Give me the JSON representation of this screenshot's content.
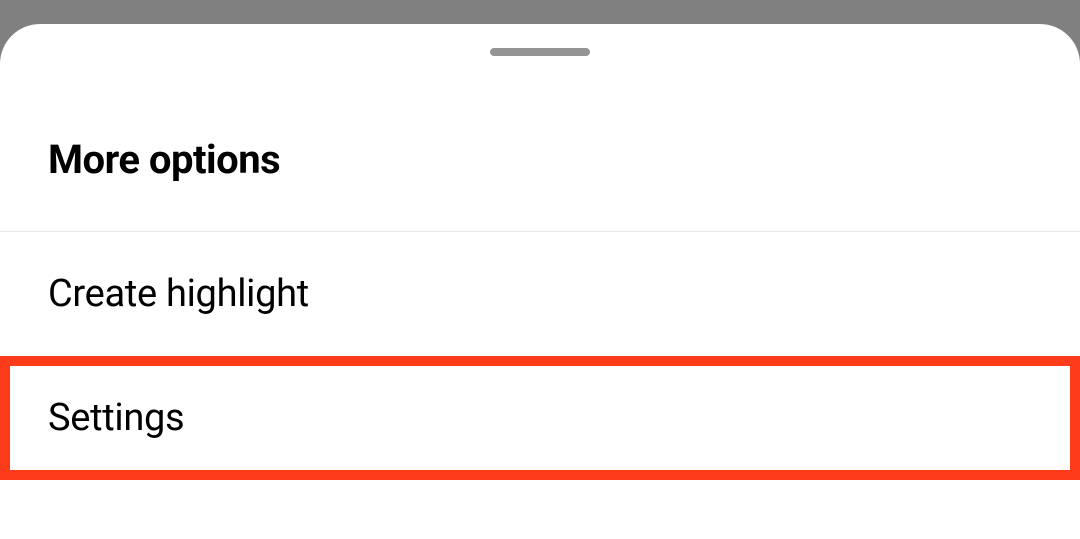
{
  "sheet": {
    "title": "More options",
    "items": [
      {
        "label": "Create highlight"
      },
      {
        "label": "Settings"
      }
    ]
  }
}
